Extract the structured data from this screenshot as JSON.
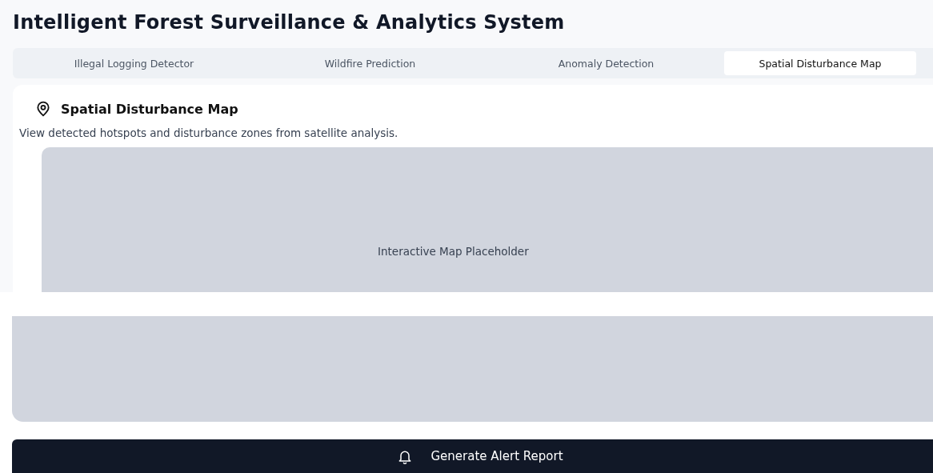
{
  "title": "Intelligent Forest Surveillance & Analytics System",
  "tabs": [
    {
      "label": "Illegal Logging Detector",
      "selected": false
    },
    {
      "label": "Wildfire Prediction",
      "selected": false
    },
    {
      "label": "Anomaly Detection",
      "selected": false
    },
    {
      "label": "Spatial Disturbance Map",
      "selected": true
    }
  ],
  "panel": {
    "heading": "Spatial Disturbance Map",
    "description": "View detected hotspots and disturbance zones from satellite analysis.",
    "map_placeholder": "Interactive Map Placeholder"
  },
  "action_button": "Generate Alert Report"
}
